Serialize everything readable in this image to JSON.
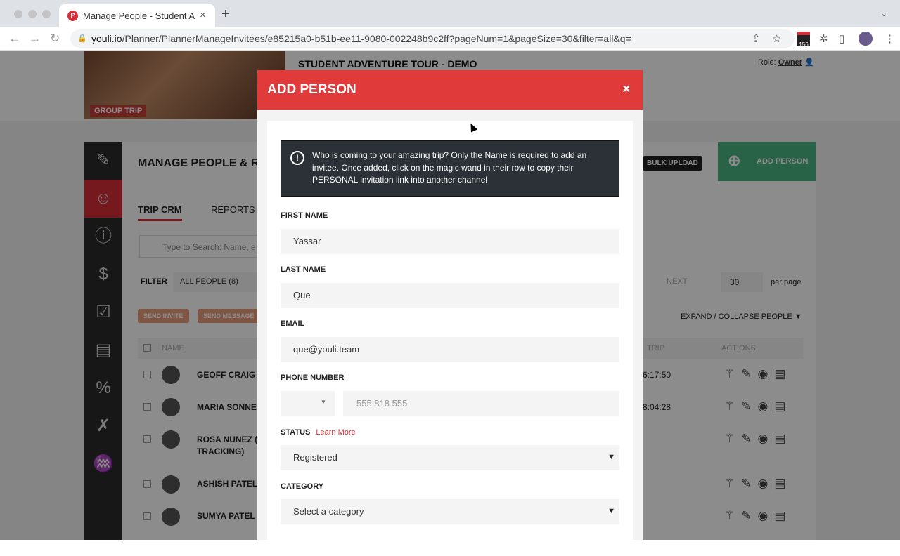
{
  "browser": {
    "tab_title": "Manage People - Student Adve",
    "url_host": "youli.io",
    "url_path": "/Planner/PlannerManageInvitees/e85215a0-b51b-ee11-9080-002248b9c2ff?pageNum=1&pageSize=30&filter=all&q=",
    "ext_badge": "156"
  },
  "header": {
    "trip_title": "STUDENT ADVENTURE TOUR - DEMO",
    "group_trip": "GROUP TRIP",
    "role_label": "Role:",
    "role_value": "Owner"
  },
  "main": {
    "title": "MANAGE PEOPLE & RE",
    "bulk_upload": "BULK UPLOAD",
    "add_person": "ADD PERSON",
    "tabs": [
      "TRIP CRM",
      "REPORTS"
    ],
    "search_placeholder": "Type to Search: Name, e",
    "filter_label": "FILTER",
    "filter_value": "ALL PEOPLE (8)",
    "next": "NEXT",
    "page_size": "30",
    "per_page": "per page",
    "send_invite": "SEND INVITE",
    "send_message": "SEND MESSAGE",
    "expand": "EXPAND / COLLAPSE PEOPLE",
    "col_name": "NAME",
    "col_trip": "TRIP",
    "col_actions": "ACTIONS",
    "rows": [
      {
        "name": "GEOFF CRAIG",
        "time": "6:17:50"
      },
      {
        "name": "MARIA SONNEN",
        "time": "8:04:28"
      },
      {
        "name": "ROSA NUNEZ (C",
        "name2": "TRACKING)",
        "time": ""
      },
      {
        "name": "ASHISH PATEL",
        "time": ""
      },
      {
        "name": "SUMYA PATEL",
        "time": ""
      }
    ]
  },
  "modal": {
    "title": "ADD PERSON",
    "close": "×",
    "notice": "Who is coming to your amazing trip? Only the Name is required to add an invitee. Once added, click on the magic wand in their row to copy their PERSONAL invitation link into another channel",
    "first_name_label": "FIRST NAME",
    "first_name_value": "Yassar",
    "last_name_label": "LAST NAME",
    "last_name_value": "Que",
    "email_label": "EMAIL",
    "email_value": "que@youli.team",
    "phone_label": "PHONE NUMBER",
    "phone_placeholder": "555 818 555",
    "status_label": "STATUS",
    "learn_more": "Learn More",
    "status_value": "Registered",
    "category_label": "CATEGORY",
    "category_value": "Select a category"
  }
}
